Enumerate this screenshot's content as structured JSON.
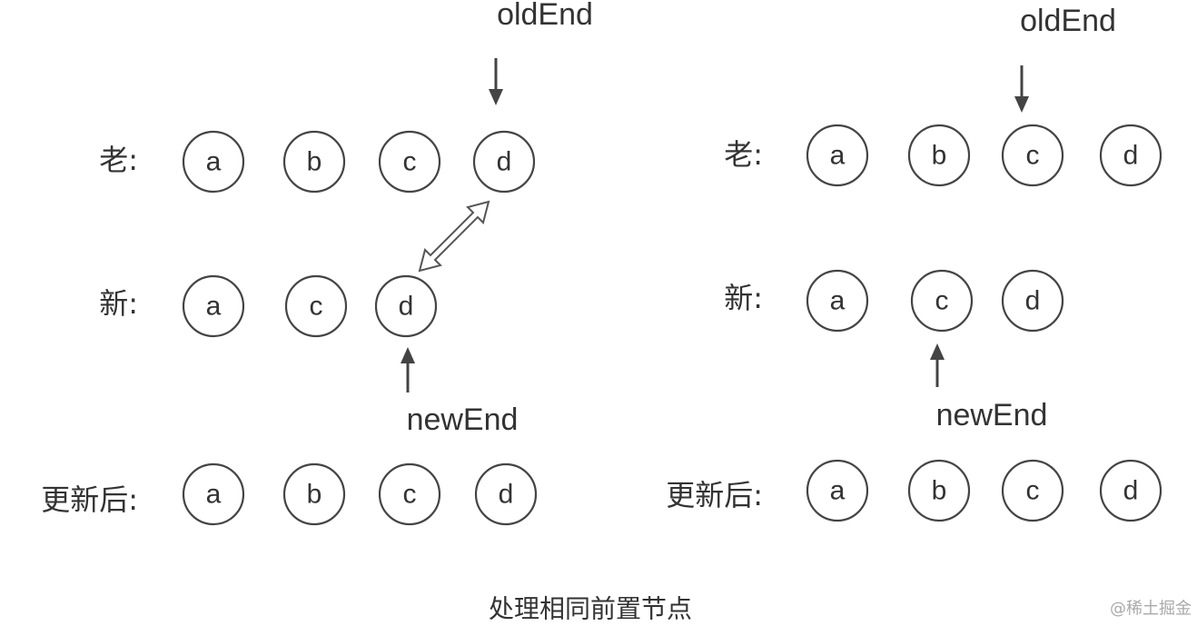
{
  "panels": [
    {
      "old_label": "老:",
      "new_label": "新:",
      "result_label": "更新后:",
      "old_nodes": [
        "a",
        "b",
        "c",
        "d"
      ],
      "new_nodes": [
        "a",
        "c",
        "d"
      ],
      "result_nodes": [
        "a",
        "b",
        "c",
        "d"
      ],
      "old_pointer": "oldEnd",
      "new_pointer": "newEnd"
    },
    {
      "old_label": "老:",
      "new_label": "新:",
      "result_label": "更新后:",
      "old_nodes": [
        "a",
        "b",
        "c",
        "d"
      ],
      "new_nodes": [
        "a",
        "c",
        "d"
      ],
      "result_nodes": [
        "a",
        "b",
        "c",
        "d"
      ],
      "old_pointer": "oldEnd",
      "new_pointer": "newEnd"
    }
  ],
  "caption": "处理相同前置节点",
  "watermark": "@稀土掘金",
  "colors": {
    "stroke": "#444444",
    "text": "#333333",
    "watermark": "#aaaaaa"
  }
}
